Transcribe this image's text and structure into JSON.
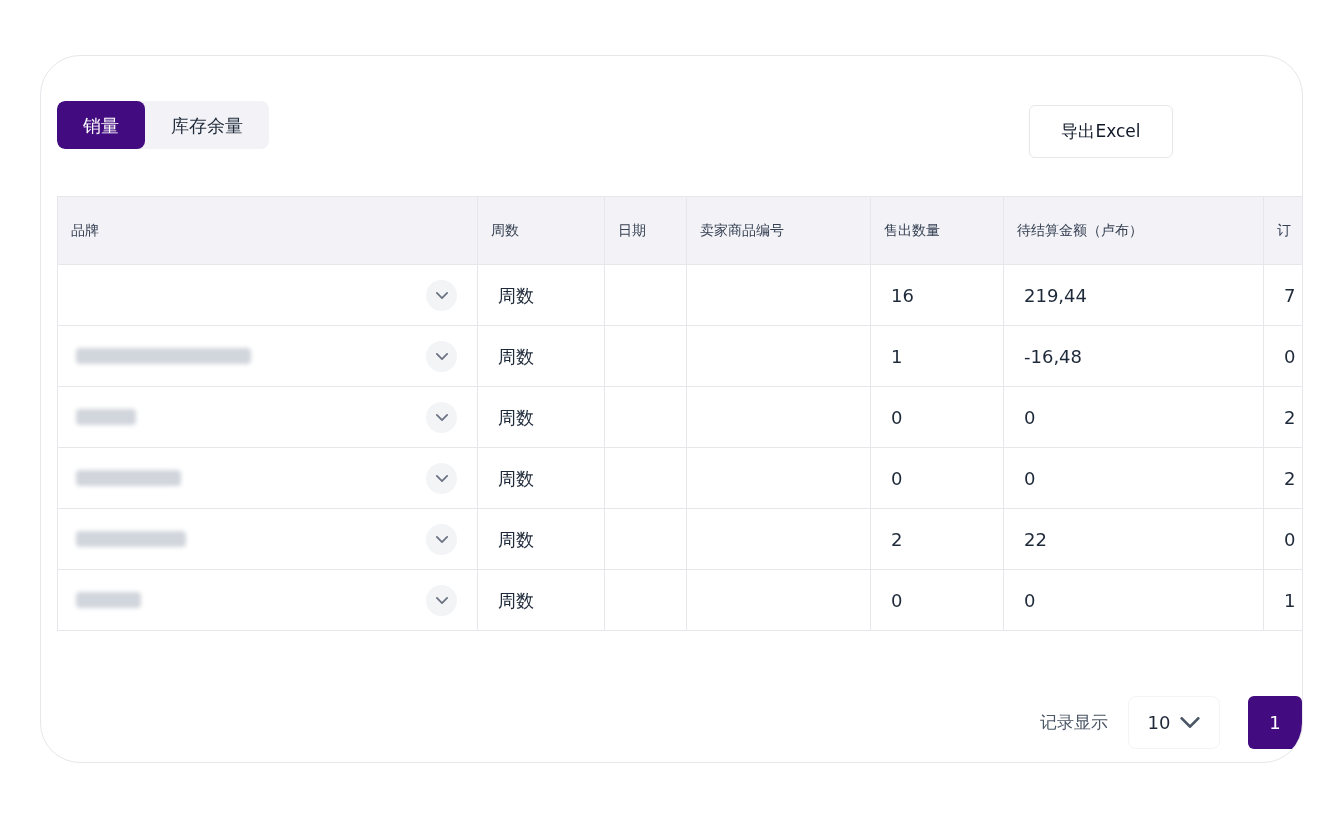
{
  "tabs": [
    {
      "label": "销量",
      "selected": true
    },
    {
      "label": "库存余量",
      "selected": false
    }
  ],
  "export_button": "导出Excel",
  "table": {
    "columns": [
      "品牌",
      "周数",
      "日期",
      "卖家商品编号",
      "售出数量",
      "待结算金额（卢布）",
      "订"
    ],
    "rows": [
      {
        "brand_blurred": false,
        "week": "周数",
        "sold": "16",
        "amount": "219,44",
        "column_7": "7"
      },
      {
        "brand_blurred": true,
        "week": "周数",
        "sold": "1",
        "amount": "-16,48",
        "column_7": "0"
      },
      {
        "brand_blurred": true,
        "week": "周数",
        "sold": "0",
        "amount": "0",
        "column_7": "2"
      },
      {
        "brand_blurred": true,
        "week": "周数",
        "sold": "0",
        "amount": "0",
        "column_7": "2"
      },
      {
        "brand_blurred": true,
        "week": "周数",
        "sold": "2",
        "amount": "22",
        "column_7": "0"
      },
      {
        "brand_blurred": true,
        "week": "周数",
        "sold": "0",
        "amount": "0",
        "column_7": "1"
      }
    ]
  },
  "pagination": {
    "label": "记录显示",
    "page_size": "10",
    "pages": [
      {
        "label": "1",
        "selected": true
      }
    ]
  }
}
